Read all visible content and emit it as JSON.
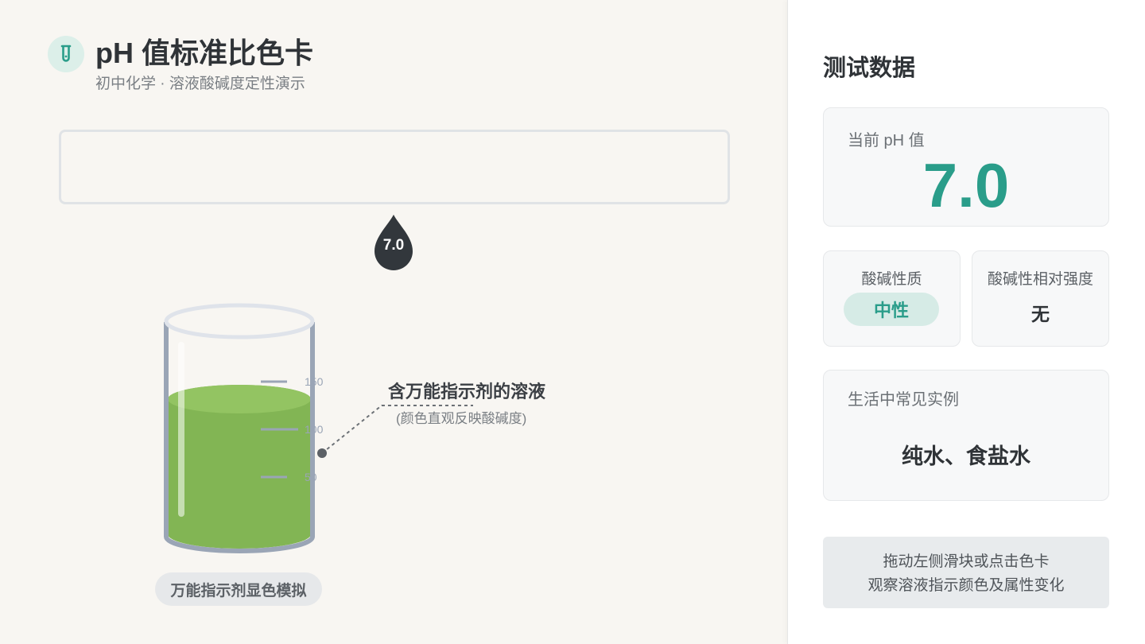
{
  "header": {
    "title": "pH 值标准比色卡",
    "subtitle": "初中化学 · 溶液酸碱度定性演示"
  },
  "marker": {
    "value": "7.0"
  },
  "beaker": {
    "ticks": [
      "150",
      "100",
      "50"
    ],
    "solution_color": "#82b554",
    "annotation_title": "含万能指示剂的溶液",
    "annotation_sub": "(颜色直观反映酸碱度)",
    "caption": "万能指示剂显色模拟"
  },
  "panel": {
    "title": "测试数据",
    "ph_label": "当前 pH 值",
    "ph_value": "7.0",
    "nature_label": "酸碱性质",
    "nature_value": "中性",
    "strength_label": "酸碱性相对强度",
    "strength_value": "无",
    "example_label": "生活中常见实例",
    "example_value": "纯水、食盐水",
    "hint_line1": "拖动左侧滑块或点击色卡",
    "hint_line2": "观察溶液指示颜色及属性变化"
  },
  "colors": {
    "accent": "#2a9d8a",
    "marker": "#32373c",
    "solution": "#82b554",
    "solution_top": "#93c462"
  },
  "icons": {
    "logo": "test-tube-icon",
    "marker": "drop-marker-icon"
  }
}
